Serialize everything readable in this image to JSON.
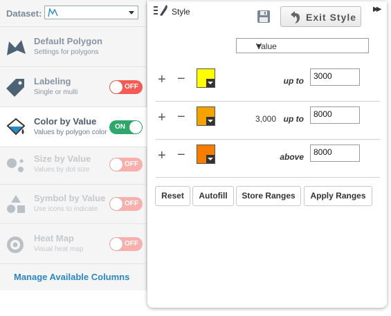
{
  "dataset": {
    "label": "Dataset:"
  },
  "layers": [
    {
      "title": "Default Polygon",
      "subtitle": "Settings for polygons",
      "icon": "polygon-icon"
    },
    {
      "title": "Labeling",
      "subtitle": "Single or multi",
      "icon": "tag-icon",
      "toggle": "OFF"
    },
    {
      "title": "Color by Value",
      "subtitle": "Values by polygon color",
      "icon": "paint-bucket-icon",
      "toggle": "ON"
    },
    {
      "title": "Size by Value",
      "subtitle": "Values by dot size",
      "icon": "dots-icon",
      "toggle": "OFF"
    },
    {
      "title": "Symbol by Value",
      "subtitle": "Use icons to indicate",
      "icon": "shapes-icon",
      "toggle": "OFF"
    },
    {
      "title": "Heat Map",
      "subtitle": "Visual heat map",
      "icon": "heatmap-icon",
      "toggle": "OFF"
    }
  ],
  "manage_columns": "Manage Available Columns",
  "style_panel": {
    "title": "Style",
    "exit_label": "Exit Style",
    "value_select": "Value",
    "ranges": [
      {
        "color": "#ffff00",
        "from": "",
        "op": "up to",
        "value": "3000"
      },
      {
        "color": "#f5a300",
        "from": "3,000",
        "op": "up to",
        "value": "8000"
      },
      {
        "color": "#f57d00",
        "from": "",
        "op": "above",
        "value": "8000"
      }
    ],
    "buttons": {
      "reset": "Reset",
      "autofill": "Autofill",
      "store": "Store Ranges",
      "apply": "Apply Ranges"
    }
  },
  "colors": {
    "toggle_on": "#2ea86a",
    "toggle_off": "#f25c54",
    "link": "#2a87c2"
  }
}
